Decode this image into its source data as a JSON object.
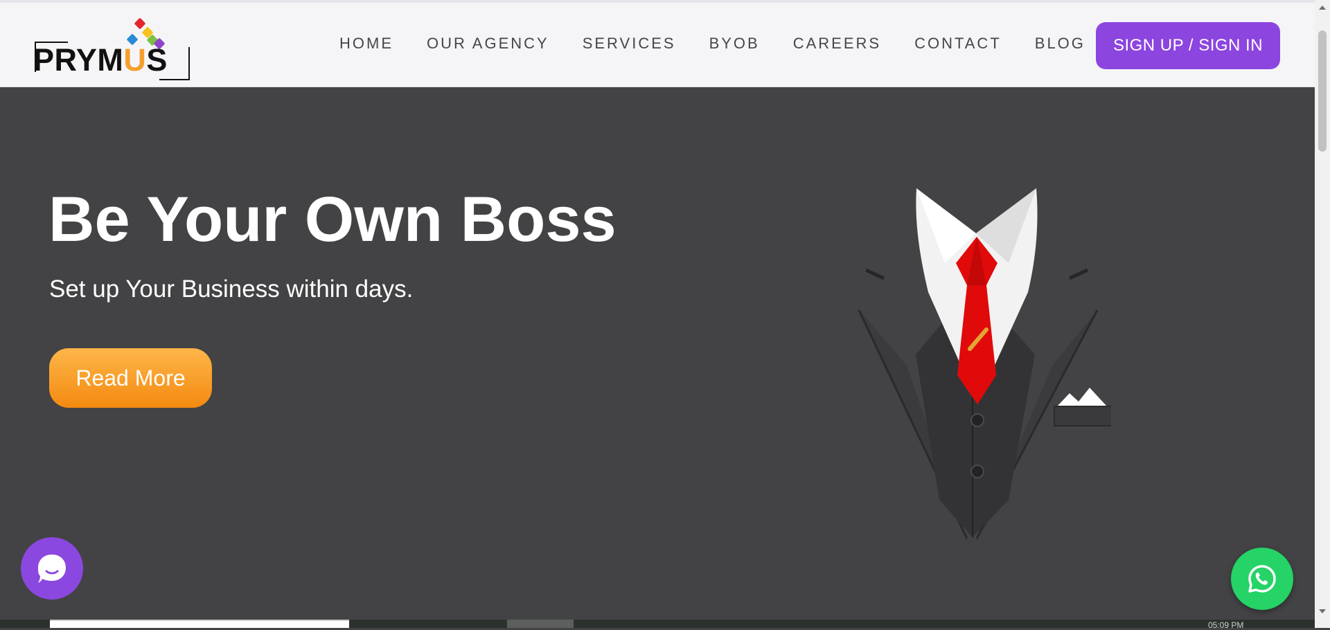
{
  "logo": {
    "text_pre": "PRYM",
    "text_u": "U",
    "text_post": "S"
  },
  "nav": {
    "items": [
      "HOME",
      "OUR AGENCY",
      "SERVICES",
      "BYOB",
      "CAREERS",
      "CONTACT",
      "BLOG"
    ],
    "cta_label": "SIGN UP / SIGN IN"
  },
  "hero": {
    "title": "Be Your Own Boss",
    "subtitle": "Set up Your Business within days.",
    "button_label": "Read More"
  },
  "colors": {
    "accent_purple": "#8c45df",
    "accent_orange": "#f48a10",
    "hero_background": "#434345",
    "whatsapp_green": "#25d366",
    "tie_red": "#e10a0a"
  },
  "icons": {
    "chat": "chat-bubble-icon",
    "whatsapp": "whatsapp-icon",
    "hero_image": "suit-and-tie-illustration"
  },
  "bottom": {
    "time_text": "05:09 PM"
  }
}
